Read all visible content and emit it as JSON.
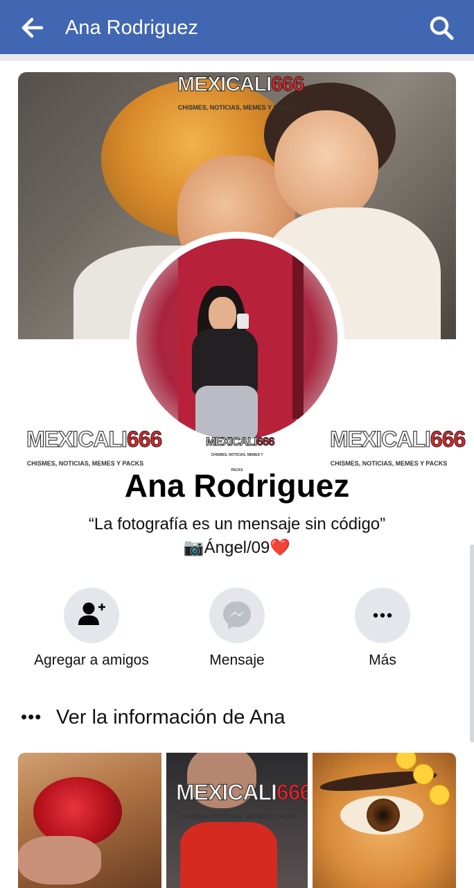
{
  "header": {
    "title": "Ana Rodriguez",
    "back_icon": "arrow-left-icon",
    "search_icon": "search-icon",
    "bar_color": "#4267b2"
  },
  "cover": {
    "watermark_main": "MEXICALI",
    "watermark_number": "666",
    "watermark_sub": "CHISMES, NOTICIAS, MEMES Y PACKS"
  },
  "profile": {
    "name": "Ana Rodriguez",
    "bio_line1": "“La fotografía es un mensaje sin código”",
    "bio_line2": "📷Ángel/09❤️"
  },
  "watermarks": {
    "main": "MEXICALI",
    "number": "666",
    "sub": "CHISMES, NOTICIAS, MEMES Y PACKS"
  },
  "actions": [
    {
      "label": "Agregar a amigos",
      "icon": "add-friend-icon"
    },
    {
      "label": "Mensaje",
      "icon": "messenger-icon"
    },
    {
      "label": "Más",
      "icon": "more-icon"
    }
  ],
  "info": {
    "dots": "•••",
    "text": "Ver la información de Ana"
  },
  "photos": [
    {
      "subject": "rose"
    },
    {
      "subject": "person-red-shirt"
    },
    {
      "subject": "eye-with-emojis"
    }
  ]
}
